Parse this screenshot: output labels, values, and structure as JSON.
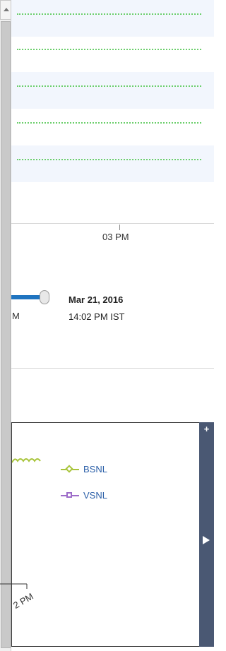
{
  "timeline": {
    "tick_label": "03 PM",
    "slider_label_fragment": "M",
    "selected_date": "Mar 21, 2016",
    "selected_time": "14:02 PM IST"
  },
  "chart": {
    "legend": [
      {
        "label": "BSNL",
        "marker": "diamond-icon",
        "color": "#a8c43a"
      },
      {
        "label": "VSNL",
        "marker": "square-icon",
        "color": "#9d6cc9"
      }
    ],
    "x_tick_label": "2 PM",
    "side_controls": {
      "expand_symbol": "+",
      "arrow": "play-right-icon"
    }
  },
  "colors": {
    "band_shade": "#f2f6fd",
    "gridline": "#6ccf6c",
    "slider_accent": "#1f74c0",
    "side_bar": "#4a5873"
  }
}
